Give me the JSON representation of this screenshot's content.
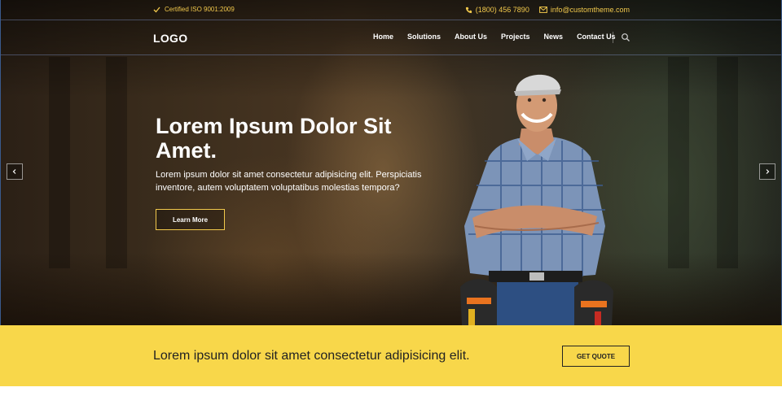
{
  "topbar": {
    "certification": "Certified ISO 9001:2009",
    "phone": "(1800) 456 7890",
    "email": "info@customtheme.com"
  },
  "nav": {
    "logo": "LOGO",
    "items": [
      {
        "label": "Home"
      },
      {
        "label": "Solutions"
      },
      {
        "label": "About Us"
      },
      {
        "label": "Projects"
      },
      {
        "label": "News"
      },
      {
        "label": "Contact Us"
      }
    ]
  },
  "hero": {
    "title": "Lorem Ipsum Dolor Sit Amet.",
    "description": "Lorem ipsum dolor sit amet consectetur adipisicing elit. Perspiciatis inventore, autem voluptatem voluptatibus molestias tempora?",
    "button_label": "Learn More"
  },
  "cta": {
    "text": "Lorem ipsum dolor sit amet consectetur adipisicing elit.",
    "button_label": "GET QUOTE"
  },
  "icons": {
    "check": "check-icon",
    "phone": "phone-icon",
    "email": "envelope-icon",
    "search": "search-icon",
    "prev": "chevron-left-icon",
    "next": "chevron-right-icon"
  },
  "colors": {
    "accent": "#f2c94c",
    "cta_background": "#f8d74a",
    "text_dark": "#222222"
  }
}
